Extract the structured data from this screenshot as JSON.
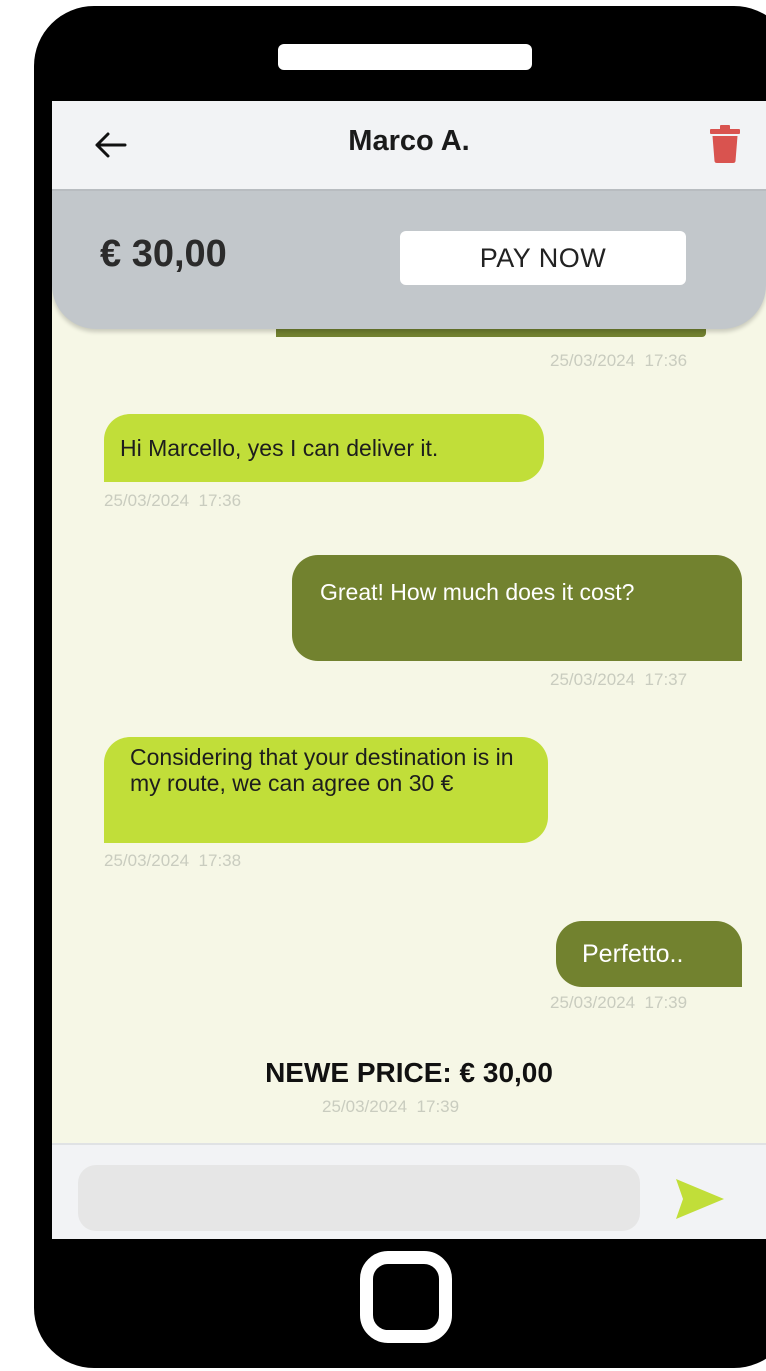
{
  "header": {
    "contact_name": "Marco A.",
    "back_icon": "arrow-left-icon",
    "delete_icon": "trash-icon",
    "delete_color": "#d9534f"
  },
  "payment": {
    "amount": "€ 30,00",
    "pay_button_label": "PAY NOW"
  },
  "messages": [
    {
      "direction": "outgoing",
      "text": "",
      "timestamp": "25/03/2024  17:36"
    },
    {
      "direction": "incoming",
      "text": "Hi Marcello, yes I can deliver it.",
      "timestamp": "25/03/2024  17:36"
    },
    {
      "direction": "outgoing",
      "text": "Great! How much does it cost?",
      "timestamp": "25/03/2024  17:37"
    },
    {
      "direction": "incoming",
      "text": "Considering that your destination is in my route, we can agree on 30 €",
      "timestamp": "25/03/2024  17:38"
    },
    {
      "direction": "outgoing",
      "text": "Perfetto..",
      "timestamp": "25/03/2024  17:39"
    }
  ],
  "system_message": {
    "text": "NEWE PRICE: € 30,00",
    "timestamp": "25/03/2024  17:39"
  },
  "composer": {
    "value": "",
    "placeholder": "",
    "send_icon": "send-arrow-icon",
    "send_color": "#c1de39"
  },
  "colors": {
    "incoming_bubble": "#c1de39",
    "outgoing_bubble": "#72822f",
    "chat_background": "#f6f7e6",
    "banner_background": "#c2c7cb"
  }
}
